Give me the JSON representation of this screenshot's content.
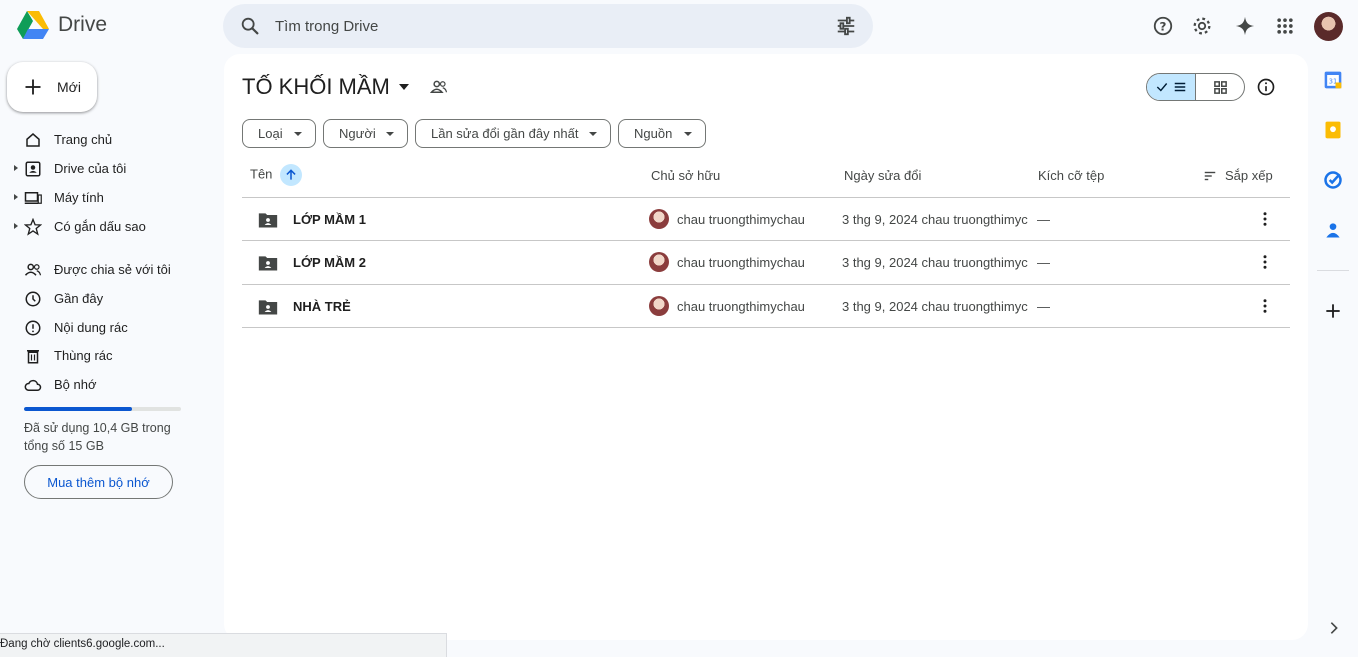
{
  "app": {
    "name": "Drive"
  },
  "search": {
    "placeholder": "Tìm trong Drive"
  },
  "sidebar": {
    "new_label": "Mới",
    "items": [
      {
        "label": "Trang chủ"
      },
      {
        "label": "Drive của tôi"
      },
      {
        "label": "Máy tính"
      },
      {
        "label": "Có gắn dấu sao"
      },
      {
        "label": "Được chia sẻ với tôi"
      },
      {
        "label": "Gần đây"
      },
      {
        "label": "Nội dung rác"
      },
      {
        "label": "Thùng rác"
      },
      {
        "label": "Bộ nhớ"
      }
    ],
    "storage": {
      "used_fraction": 0.69,
      "text": "Đã sử dụng 10,4 GB trong tổng số 15 GB",
      "buy_label": "Mua thêm bộ nhớ"
    }
  },
  "main": {
    "folder_title": "TỐ KHỐI MẦM",
    "filters": [
      "Loại",
      "Người",
      "Lần sửa đổi gần đây nhất",
      "Nguồn"
    ],
    "columns": {
      "name": "Tên",
      "owner": "Chủ sở hữu",
      "modified": "Ngày sửa đổi",
      "size": "Kích cỡ tệp",
      "sort": "Sắp xếp"
    },
    "rows": [
      {
        "name": "LỚP MẦM 1",
        "owner": "chau truongthimychau",
        "modified": "3 thg 9, 2024 chau truongthimyc",
        "size": "—"
      },
      {
        "name": "LỚP MẦM 2",
        "owner": "chau truongthimychau",
        "modified": "3 thg 9, 2024 chau truongthimyc",
        "size": "—"
      },
      {
        "name": "NHÀ TRẺ",
        "owner": "chau truongthimychau",
        "modified": "3 thg 9, 2024 chau truongthimyc",
        "size": "—"
      }
    ]
  },
  "status_bar": {
    "text": "Đang chờ clients6.google.com..."
  },
  "colors": {
    "accent": "#0b57d0",
    "selected": "#c2e7ff",
    "background": "#f8fafd"
  }
}
